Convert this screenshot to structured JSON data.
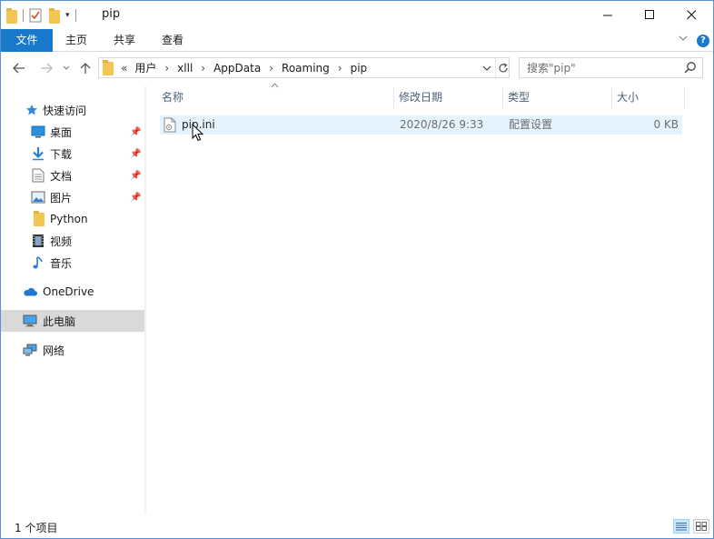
{
  "window": {
    "title": "pip",
    "controls": {
      "minimize": "—",
      "maximize": "☐",
      "close": "✕"
    }
  },
  "ribbon": {
    "tabs": [
      {
        "label": "文件"
      },
      {
        "label": "主页"
      },
      {
        "label": "共享"
      },
      {
        "label": "查看"
      }
    ]
  },
  "address": {
    "overflow": "«",
    "crumbs": [
      "用户",
      "xlll",
      "AppData",
      "Roaming",
      "pip"
    ]
  },
  "search": {
    "placeholder": "搜索\"pip\""
  },
  "sidebar": {
    "quick_access": "快速访问",
    "items": [
      {
        "label": "桌面",
        "icon": "desktop-icon",
        "pinned": true
      },
      {
        "label": "下载",
        "icon": "download-icon",
        "pinned": true
      },
      {
        "label": "文档",
        "icon": "document-icon",
        "pinned": true
      },
      {
        "label": "图片",
        "icon": "pictures-icon",
        "pinned": true
      },
      {
        "label": "Python",
        "icon": "folder-icon",
        "pinned": false
      },
      {
        "label": "视频",
        "icon": "video-icon",
        "pinned": false
      },
      {
        "label": "音乐",
        "icon": "music-icon",
        "pinned": false
      }
    ],
    "onedrive": "OneDrive",
    "this_pc": "此电脑",
    "network": "网络"
  },
  "columns": {
    "name": "名称",
    "date": "修改日期",
    "type": "类型",
    "size": "大小"
  },
  "files": [
    {
      "name": "pip.ini",
      "date": "2020/8/26 9:33",
      "type": "配置设置",
      "size": "0 KB"
    }
  ],
  "status": {
    "count": "1 个项目"
  },
  "colors": {
    "accent": "#1979ca",
    "selection": "#e5f3ff",
    "header_text": "#4c607a",
    "folder": "#f3c653"
  }
}
